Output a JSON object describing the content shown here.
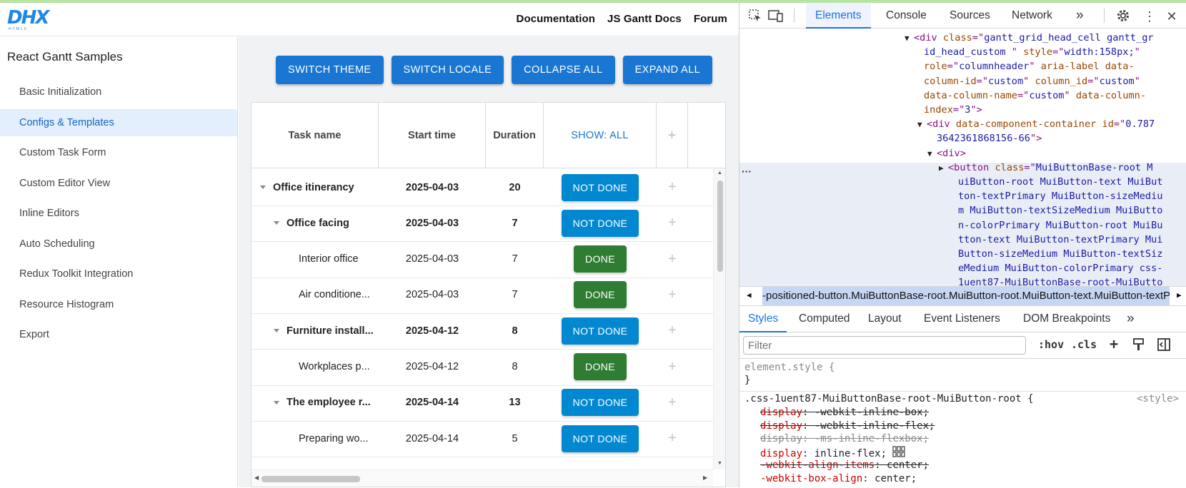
{
  "app": {
    "logo_text": "DHX",
    "logo_sub": "HTMLX",
    "nav": [
      "Documentation",
      "JS Gantt Docs",
      "Forum"
    ],
    "sidebar_title": "React Gantt Samples",
    "sidebar_items": [
      "Basic Initialization",
      "Configs & Templates",
      "Custom Task Form",
      "Custom Editor View",
      "Inline Editors",
      "Auto Scheduling",
      "Redux Toolkit Integration",
      "Resource Histogram",
      "Export"
    ],
    "active_item": "Configs & Templates",
    "buttons": [
      "SWITCH THEME",
      "SWITCH LOCALE",
      "COLLAPSE ALL",
      "EXPAND ALL"
    ],
    "columns": [
      "Task name",
      "Start time",
      "Duration",
      "SHOW: ALL",
      "+"
    ],
    "rows": [
      {
        "name": "Office itinerancy",
        "start": "2025-04-03",
        "duration": "20",
        "status": "NOT DONE",
        "level": 0,
        "parent": true
      },
      {
        "name": "Office facing",
        "start": "2025-04-03",
        "duration": "7",
        "status": "NOT DONE",
        "level": 1,
        "parent": true
      },
      {
        "name": "Interior office",
        "start": "2025-04-03",
        "duration": "7",
        "status": "DONE",
        "level": 2,
        "parent": false
      },
      {
        "name": "Air conditione...",
        "start": "2025-04-03",
        "duration": "7",
        "status": "DONE",
        "level": 2,
        "parent": false
      },
      {
        "name": "Furniture install...",
        "start": "2025-04-12",
        "duration": "8",
        "status": "NOT DONE",
        "level": 1,
        "parent": true
      },
      {
        "name": "Workplaces p...",
        "start": "2025-04-12",
        "duration": "8",
        "status": "DONE",
        "level": 2,
        "parent": false
      },
      {
        "name": "The employee r...",
        "start": "2025-04-14",
        "duration": "13",
        "status": "NOT DONE",
        "level": 1,
        "parent": true
      },
      {
        "name": "Preparing wo...",
        "start": "2025-04-14",
        "duration": "5",
        "status": "NOT DONE",
        "level": 2,
        "parent": false
      }
    ],
    "row_plus": "+",
    "colors": {
      "primary": "#1976d2",
      "not_done": "#0288d1",
      "done": "#2e7d32",
      "sidebar_active": "#e3effd"
    }
  },
  "devtools": {
    "tabs": [
      "Elements",
      "Console",
      "Sources",
      "Network"
    ],
    "active_tab": "Elements",
    "more": "»",
    "elements_lines": [
      {
        "indent": 0,
        "tri": "▼",
        "parts": [
          [
            "tag",
            "<div "
          ],
          [
            "attr",
            "class"
          ],
          [
            "tag",
            "=\""
          ],
          [
            "aval",
            "gantt_grid_head_cell gantt_gr"
          ]
        ]
      },
      {
        "indent": 1,
        "tri": "",
        "parts": [
          [
            "aval",
            "id_head_custom  "
          ],
          [
            "tag",
            "\" "
          ],
          [
            "attr",
            "style"
          ],
          [
            "tag",
            "=\""
          ],
          [
            "aval",
            "width:158px;"
          ],
          [
            "tag",
            "\""
          ]
        ]
      },
      {
        "indent": 1,
        "tri": "",
        "parts": [
          [
            "attr",
            "role"
          ],
          [
            "tag",
            "=\""
          ],
          [
            "aval",
            "columnheader"
          ],
          [
            "tag",
            "\" "
          ],
          [
            "attr",
            "aria-label data-"
          ]
        ]
      },
      {
        "indent": 1,
        "tri": "",
        "parts": [
          [
            "attr",
            "column-id"
          ],
          [
            "tag",
            "=\""
          ],
          [
            "aval",
            "custom"
          ],
          [
            "tag",
            "\" "
          ],
          [
            "attr",
            "column_id"
          ],
          [
            "tag",
            "=\""
          ],
          [
            "aval",
            "custom"
          ],
          [
            "tag",
            "\""
          ]
        ]
      },
      {
        "indent": 1,
        "tri": "",
        "parts": [
          [
            "attr",
            "data-column-name"
          ],
          [
            "tag",
            "=\""
          ],
          [
            "aval",
            "custom"
          ],
          [
            "tag",
            "\" "
          ],
          [
            "attr",
            "data-column-"
          ]
        ]
      },
      {
        "indent": 1,
        "tri": "",
        "parts": [
          [
            "attr",
            "index"
          ],
          [
            "tag",
            "=\""
          ],
          [
            "aval",
            "3"
          ],
          [
            "tag",
            "\">"
          ]
        ]
      },
      {
        "indent": 2,
        "tri": "▼",
        "parts": [
          [
            "tag",
            "<div "
          ],
          [
            "attr",
            "data-component-container"
          ],
          [
            "tag",
            " "
          ],
          [
            "attr",
            "id"
          ],
          [
            "tag",
            "=\""
          ],
          [
            "aval",
            "0.787"
          ]
        ]
      },
      {
        "indent": 3,
        "tri": "",
        "parts": [
          [
            "aval",
            "3642361868156-66"
          ],
          [
            "tag",
            "\">"
          ]
        ]
      },
      {
        "indent": 3,
        "tri": "▼",
        "parts": [
          [
            "tag",
            "<div>"
          ]
        ]
      },
      {
        "indent": 4,
        "tri": "▶",
        "parts": [
          [
            "tag",
            "<button "
          ],
          [
            "attr",
            "class"
          ],
          [
            "tag",
            "=\""
          ],
          [
            "aval",
            "MuiButtonBase-root M"
          ]
        ]
      },
      {
        "indent": 5,
        "tri": "",
        "parts": [
          [
            "aval",
            "uiButton-root MuiButton-text MuiBut"
          ]
        ]
      },
      {
        "indent": 5,
        "tri": "",
        "parts": [
          [
            "aval",
            "ton-textPrimary MuiButton-sizeMediu"
          ]
        ]
      },
      {
        "indent": 5,
        "tri": "",
        "parts": [
          [
            "aval",
            "m MuiButton-textSizeMedium MuiButto"
          ]
        ]
      },
      {
        "indent": 5,
        "tri": "",
        "parts": [
          [
            "aval",
            "n-colorPrimary MuiButton-root MuiBu"
          ]
        ]
      },
      {
        "indent": 5,
        "tri": "",
        "parts": [
          [
            "aval",
            "tton-text MuiButton-textPrimary Mui"
          ]
        ]
      },
      {
        "indent": 5,
        "tri": "",
        "parts": [
          [
            "aval",
            "Button-sizeMedium MuiButton-textSiz"
          ]
        ]
      },
      {
        "indent": 5,
        "tri": "",
        "parts": [
          [
            "aval",
            "eMedium MuiButton-colorPrimary css-"
          ]
        ]
      },
      {
        "indent": 5,
        "tri": "",
        "parts": [
          [
            "aval",
            "1uent87-MuiButtonBase-root-MuiButto"
          ]
        ]
      }
    ],
    "breadcrumb": "-positioned-button.MuiButtonBase-root.MuiButton-root.MuiButton-text.MuiButton-textPrimary",
    "style_tabs": [
      "Styles",
      "Computed",
      "Layout",
      "Event Listeners",
      "DOM Breakpoints"
    ],
    "active_style_tab": "Styles",
    "filter_placeholder": "Filter",
    "filter_tools": [
      ":hov",
      ".cls",
      "+"
    ],
    "element_style": "element.style {",
    "element_style_close": "}",
    "rule_selector": ".css-1uent87-MuiButtonBase-root-MuiButton-root {",
    "rule_source": "<style>",
    "declarations": [
      {
        "prop": "display",
        "value": "-webkit-inline-box;",
        "strike": true,
        "gray": false
      },
      {
        "prop": "display",
        "value": "-webkit-inline-flex;",
        "strike": true,
        "gray": false
      },
      {
        "prop": "display",
        "value": "-ms-inline-flexbox;",
        "strike": true,
        "gray": true
      },
      {
        "prop": "display",
        "value": "inline-flex;",
        "strike": false,
        "gray": false
      },
      {
        "prop": "-webkit-align-items",
        "value": "center;",
        "strike": true,
        "gray": false
      },
      {
        "prop": "-webkit-box-align",
        "value": "center;",
        "strike": false,
        "gray": false
      }
    ]
  }
}
